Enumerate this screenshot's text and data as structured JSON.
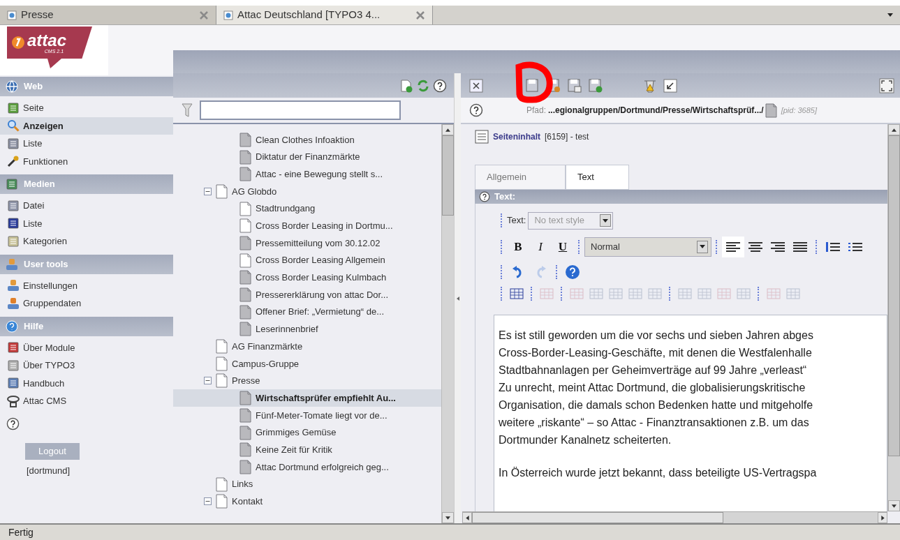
{
  "browser_tabs": [
    {
      "label": "Presse",
      "selected": false
    },
    {
      "label": "Attac Deutschland [TYPO3 4...",
      "selected": true
    }
  ],
  "logo": {
    "name": "attac",
    "subtitle": "CMS 2.1"
  },
  "sidebar": {
    "groups": [
      {
        "title": "Web",
        "items": [
          {
            "label": "Seite",
            "selected": false
          },
          {
            "label": "Anzeigen",
            "selected": true
          },
          {
            "label": "Liste",
            "selected": false
          },
          {
            "label": "Funktionen",
            "selected": false
          }
        ]
      },
      {
        "title": "Medien",
        "items": [
          {
            "label": "Datei",
            "selected": false
          },
          {
            "label": "Liste",
            "selected": false
          },
          {
            "label": "Kategorien",
            "selected": false
          }
        ]
      },
      {
        "title": "User tools",
        "items": [
          {
            "label": "Einstellungen",
            "selected": false
          },
          {
            "label": "Gruppendaten",
            "selected": false
          }
        ]
      },
      {
        "title": "Hilfe",
        "items": [
          {
            "label": "Über Module",
            "selected": false
          },
          {
            "label": "Über TYPO3",
            "selected": false
          },
          {
            "label": "Handbuch",
            "selected": false
          },
          {
            "label": "Attac CMS",
            "selected": false
          }
        ]
      }
    ],
    "logout": "Logout",
    "user": "[dortmund]"
  },
  "tree": {
    "continued_children": [
      {
        "label": "Clean Clothes Infoaktion",
        "hidden": true,
        "selected": false
      },
      {
        "label": "Diktatur der Finanzmärkte",
        "hidden": true,
        "selected": false
      },
      {
        "label": "Attac - eine Bewegung stellt s...",
        "hidden": true,
        "selected": false
      }
    ],
    "items": [
      {
        "label": "AG Globdo",
        "hidden": false,
        "selected": false,
        "expanded": true,
        "children": [
          {
            "label": "Stadtrundgang",
            "hidden": false,
            "selected": false
          },
          {
            "label": "Cross Border Leasing in Dortmu...",
            "hidden": false,
            "selected": false
          },
          {
            "label": "Pressemitteilung vom 30.12.02",
            "hidden": true,
            "selected": false
          },
          {
            "label": "Cross Border Leasing Allgemein",
            "hidden": false,
            "selected": false
          },
          {
            "label": "Cross Border Leasing Kulmbach",
            "hidden": true,
            "selected": false
          },
          {
            "label": "Pressererklärung von attac Dor...",
            "hidden": true,
            "selected": false
          },
          {
            "label": "Offener Brief: „Vermietung“ de...",
            "hidden": true,
            "selected": false
          },
          {
            "label": "Leserinnenbrief",
            "hidden": true,
            "selected": false
          }
        ]
      },
      {
        "label": "AG Finanzmärkte",
        "hidden": false,
        "selected": false
      },
      {
        "label": "Campus-Gruppe",
        "hidden": false,
        "selected": false
      },
      {
        "label": "Presse",
        "hidden": false,
        "selected": false,
        "expanded": true,
        "children": [
          {
            "label": "Wirtschaftsprüfer empfiehlt Au...",
            "hidden": true,
            "selected": true
          },
          {
            "label": "Fünf-Meter-Tomate liegt vor de...",
            "hidden": true,
            "selected": false
          },
          {
            "label": "Grimmiges Gemüse",
            "hidden": true,
            "selected": false
          },
          {
            "label": "Keine Zeit für Kritik",
            "hidden": true,
            "selected": false
          },
          {
            "label": "Attac Dortmund erfolgreich geg...",
            "hidden": true,
            "selected": false
          }
        ]
      },
      {
        "label": "Links",
        "hidden": false,
        "selected": false
      },
      {
        "label": "Kontakt",
        "hidden": false,
        "selected": false,
        "expanded": true
      }
    ]
  },
  "editor": {
    "path_label": "Pfad:",
    "path": "...egionalgruppen/Dortmund/Presse/Wirtschaftsprüf.../",
    "pid": "[pid: 3685]",
    "record": {
      "type": "Seiteninhalt",
      "info": "[6159] - test"
    },
    "tabs": [
      {
        "label": "Allgemein",
        "selected": false
      },
      {
        "label": "Text",
        "selected": true
      }
    ],
    "section": "Text:",
    "rte": {
      "text_label": "Text:",
      "text_style": "No text style",
      "format": [
        "B",
        "I",
        "U"
      ],
      "block_style": "Normal",
      "align": [
        {
          "selected": true
        },
        {
          "selected": false
        },
        {
          "selected": false
        },
        {
          "selected": false
        }
      ],
      "history": [
        {
          "disabled": false
        },
        {
          "disabled": true
        }
      ]
    },
    "paragraphs": [
      [
        "Es ist still geworden um die vor sechs und sieben Jahren abges",
        "Cross-Border-Leasing-Geschäfte, mit denen die Westfalenhalle",
        "Stadtbahnanlagen per Geheimverträge auf 99 Jahre „verleast“",
        "Zu unrecht, meint Attac Dortmund, die globalisierungskritische",
        "Organisation, die damals schon Bedenken hatte und mitgeholfe",
        "weitere „riskante“ – so Attac - Finanztransaktionen z.B. um das",
        "Dortmunder Kanalnetz scheiterten."
      ],
      [
        "In Österreich wurde jetzt bekannt, dass beteiligte US-Vertragspa"
      ]
    ]
  },
  "status_bar": "Fertig"
}
